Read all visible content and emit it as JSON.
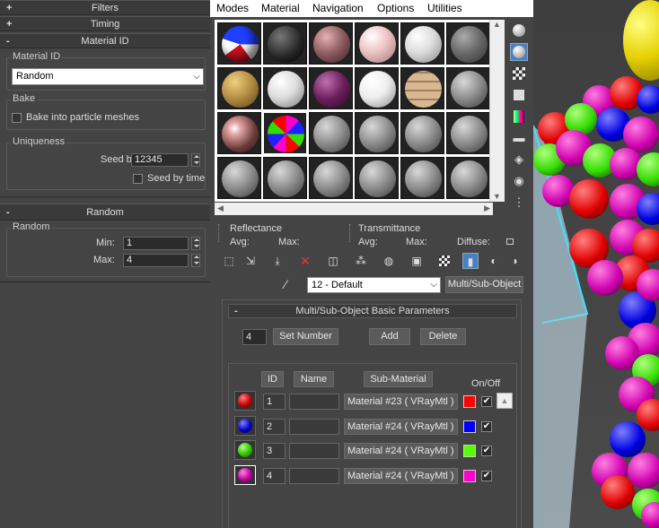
{
  "left_panel": {
    "filters_label": "Filters",
    "timing_label": "Timing",
    "material_id_header": "Material ID",
    "material_id_group": "Material ID",
    "material_id_value": "Random",
    "bake_group": "Bake",
    "bake_checkbox_label": "Bake into particle meshes",
    "uniqueness_group": "Uniqueness",
    "seed_label": "Seed by:",
    "seed_value": "12345",
    "seed_by_time_label": "Seed by time",
    "random_header": "Random",
    "random_group": "Random",
    "min_label": "Min:",
    "min_value": "1",
    "max_label": "Max:",
    "max_value": "4",
    "plus_sign": "+",
    "minus_sign": "-"
  },
  "menu": {
    "items": [
      "Modes",
      "Material",
      "Navigation",
      "Options",
      "Utilities"
    ]
  },
  "reflectance": {
    "title": "Reflectance",
    "avg": "Avg:",
    "max": "Max:"
  },
  "transmittance": {
    "title": "Transmittance",
    "avg": "Avg:",
    "max": "Max:",
    "diffuse": "Diffuse:"
  },
  "material_select": {
    "value": "12 - Default",
    "type_button": "Multi/Sub-Object"
  },
  "multi_sub": {
    "header": "Multi/Sub-Object Basic Parameters",
    "count_value": "4",
    "set_number": "Set Number",
    "add": "Add",
    "delete": "Delete",
    "col_id": "ID",
    "col_name": "Name",
    "col_submaterial": "Sub-Material",
    "col_onoff": "On/Off",
    "rows": [
      {
        "id": "1",
        "material": "Material #23  ( VRayMtl )",
        "color": "#ff0000"
      },
      {
        "id": "2",
        "material": "Material #24  ( VRayMtl )",
        "color": "#0000ff"
      },
      {
        "id": "3",
        "material": "Material #24  ( VRayMtl )",
        "color": "#55ff00"
      },
      {
        "id": "4",
        "material": "Material #24  ( VRayMtl )",
        "color": "#ff00cc"
      }
    ]
  },
  "icons": {
    "check": "✔",
    "up_arrow": "▲",
    "down_arrow": "▼",
    "left_arrow": "◀",
    "right_arrow": "▶",
    "dropdown": "⌵",
    "eyedropper": "eyedropper-icon"
  },
  "colors": {
    "panel_bg": "#444444",
    "red": "#ff0000",
    "blue": "#0000ff",
    "green": "#55ff00",
    "magenta": "#ff00cc",
    "yellow": "#ffee00"
  }
}
